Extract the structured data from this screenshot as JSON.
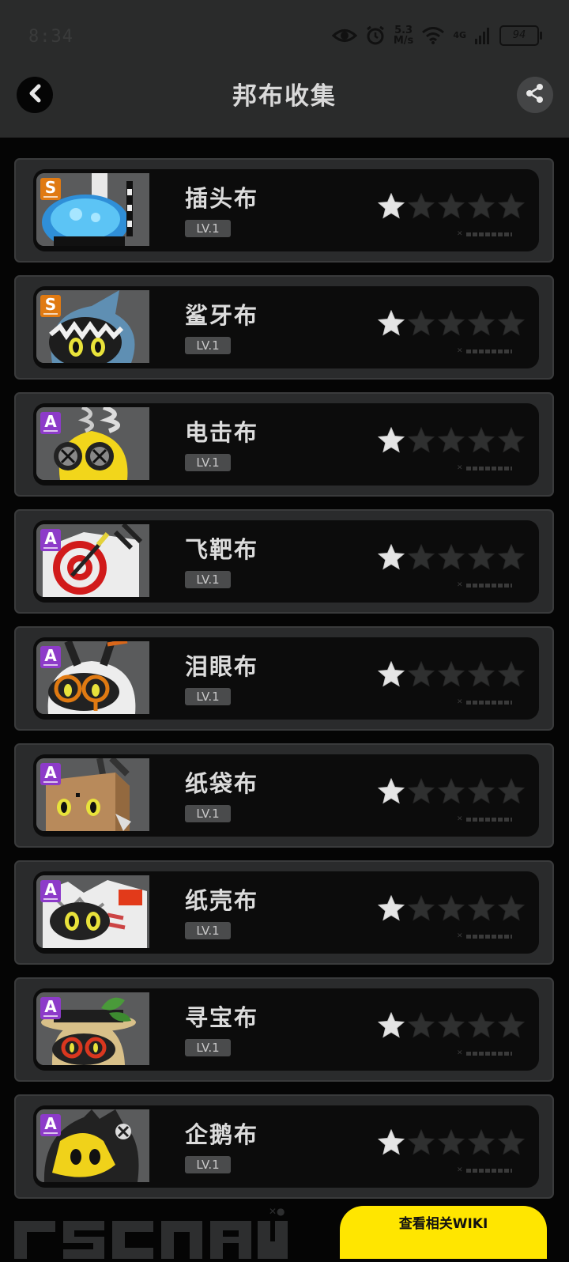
{
  "status": {
    "time": "8:34",
    "speed_top": "5.3",
    "speed_unit": "M/s",
    "network": "4G",
    "battery": "94"
  },
  "header": {
    "title": "邦布收集"
  },
  "colors": {
    "grade_s": "#e07a12",
    "grade_a": "#8d3bc9",
    "cta": "#ffe600",
    "star_filled": "#e5e5e5",
    "star_empty": "#2f3030"
  },
  "items": [
    {
      "grade": "S",
      "name": "插头布",
      "level": "LV.1",
      "stars": 1,
      "icon": "plug-bangboo-portrait"
    },
    {
      "grade": "S",
      "name": "鲨牙布",
      "level": "LV.1",
      "stars": 1,
      "icon": "shark-bangboo-portrait"
    },
    {
      "grade": "A",
      "name": "电击布",
      "level": "LV.1",
      "stars": 1,
      "icon": "electro-bangboo-portrait"
    },
    {
      "grade": "A",
      "name": "飞靶布",
      "level": "LV.1",
      "stars": 1,
      "icon": "target-bangboo-portrait"
    },
    {
      "grade": "A",
      "name": "泪眼布",
      "level": "LV.1",
      "stars": 1,
      "icon": "teary-bangboo-portrait"
    },
    {
      "grade": "A",
      "name": "纸袋布",
      "level": "LV.1",
      "stars": 1,
      "icon": "paperbag-bangboo-portrait"
    },
    {
      "grade": "A",
      "name": "纸壳布",
      "level": "LV.1",
      "stars": 1,
      "icon": "cardboard-bangboo-portrait"
    },
    {
      "grade": "A",
      "name": "寻宝布",
      "level": "LV.1",
      "stars": 1,
      "icon": "treasure-bangboo-portrait"
    },
    {
      "grade": "A",
      "name": "企鹅布",
      "level": "LV.1",
      "stars": 1,
      "icon": "penguin-bangboo-portrait"
    }
  ],
  "footer": {
    "wiki_label": "查看相关WIKI"
  }
}
